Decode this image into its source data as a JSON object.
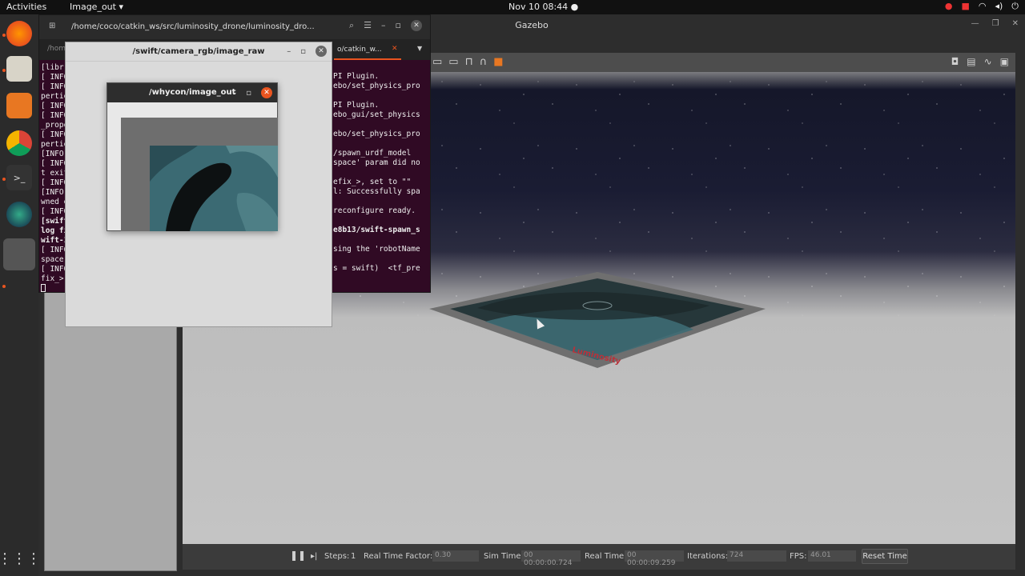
{
  "topbar": {
    "activities": "Activities",
    "app_menu": "Image_out ▾",
    "clock": "Nov 10  08:44  ●"
  },
  "gazebo": {
    "title": "Gazebo",
    "bottom": {
      "steps_label": "Steps:",
      "steps_value": "1",
      "rtf_label": "Real Time Factor:",
      "rtf_value": "0.30",
      "sim_label": "Sim Time:",
      "sim_value": "00 00:00:00.724",
      "real_label": "Real Time:",
      "real_value": "00 00:00:09.259",
      "iter_label": "Iterations:",
      "iter_value": "724",
      "fps_label": "FPS:",
      "fps_value": "46.01",
      "reset_label": "Reset Time"
    },
    "arena_label": "Luminosity"
  },
  "terminal": {
    "path": "/home/coco/catkin_ws/src/luminosity_drone/luminosity_dro...",
    "tab_left": "/hom",
    "tab_active": "o/catkin_w...",
    "left_lines": [
      "[libr",
      "[ INFO",
      "[ INFO",
      "pertie",
      "[ INFO",
      "[ INFO",
      "_prope",
      "[ INFO",
      "pertie",
      "[INFO]",
      "[ INFO",
      "t exit",
      "[ INFO",
      "[INFO]",
      "wned e",
      "[ INFO",
      "[swift",
      "log fi",
      "wift-1",
      "[ INFO",
      "space",
      "[ INFO",
      "fix_>,"
    ],
    "right_lines": [
      {
        "t": "PI Plugin.",
        "b": false
      },
      {
        "t": "ebo/set_physics_pro",
        "b": false
      },
      {
        "t": "",
        "b": false
      },
      {
        "t": "PI Plugin.",
        "b": false
      },
      {
        "t": "ebo_gui/set_physics",
        "b": false
      },
      {
        "t": "",
        "b": false
      },
      {
        "t": "ebo/set_physics_pro",
        "b": false
      },
      {
        "t": "",
        "b": false
      },
      {
        "t": "/spawn_urdf_model",
        "b": false
      },
      {
        "t": "space' param did no",
        "b": false
      },
      {
        "t": "",
        "b": false
      },
      {
        "t": "efix_>, set to \"\"",
        "b": false
      },
      {
        "t": "l: Successfully spa",
        "b": false
      },
      {
        "t": "",
        "b": false
      },
      {
        "t": "reconfigure ready.",
        "b": false
      },
      {
        "t": "",
        "b": false
      },
      {
        "t": "e8b13/swift-spawn_s",
        "b": true
      },
      {
        "t": "",
        "b": false
      },
      {
        "t": "sing the 'robotName",
        "b": false
      },
      {
        "t": "",
        "b": false
      },
      {
        "t": "s = swift)  <tf_pre",
        "b": false
      }
    ]
  },
  "camera_window": {
    "title": "/swift/camera_rgb/image_raw"
  },
  "whycon_window": {
    "title": "/whycon/image_out"
  }
}
